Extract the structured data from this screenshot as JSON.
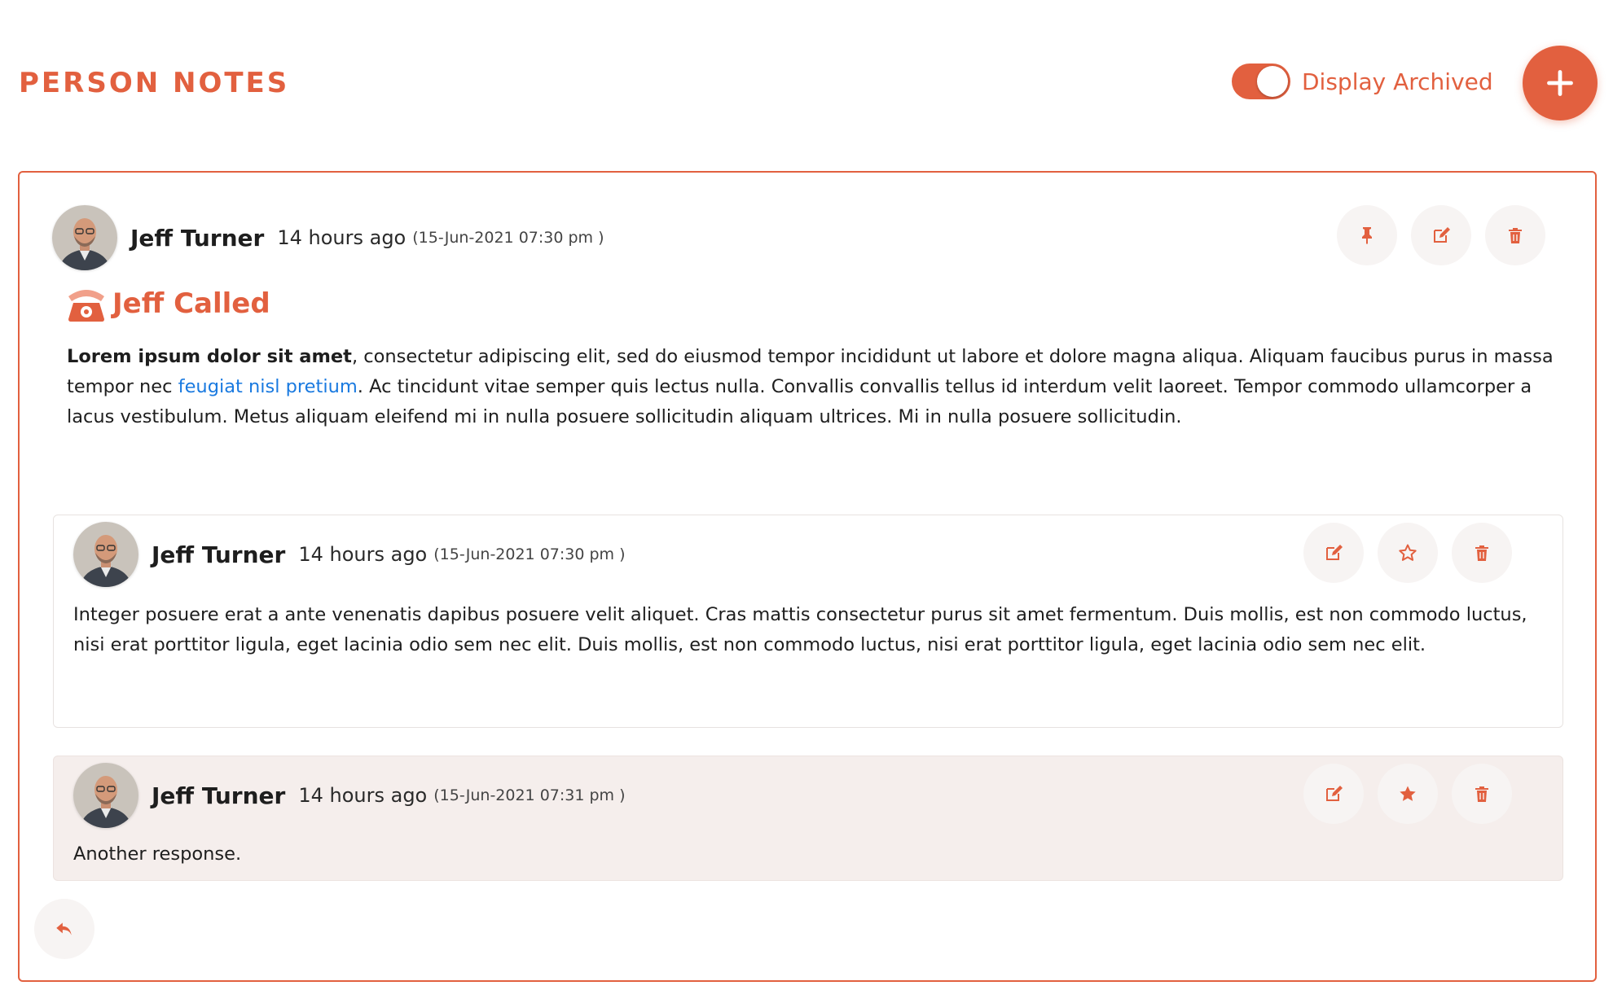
{
  "page": {
    "title": "PERSON NOTES",
    "display_archived_label": "Display Archived",
    "display_archived_on": true,
    "add_icon": "plus-icon"
  },
  "colors": {
    "accent": "#e2603f",
    "link": "#1a7ae0",
    "highlight_bg": "#f5eeec"
  },
  "note": {
    "author": "Jeff Turner",
    "time_ago": "14 hours ago",
    "timestamp": "(15-Jun-2021 07:30 pm )",
    "type_icon": "phone-icon",
    "title": "Jeff Called",
    "body_bold": "Lorem ipsum dolor sit amet",
    "body_part1": ", consectetur adipiscing elit, sed do eiusmod tempor incididunt ut labore et dolore magna aliqua. Aliquam faucibus purus in massa tempor nec ",
    "body_link": "feugiat nisl pretium",
    "body_part2": ". Ac tincidunt vitae semper quis lectus nulla. Convallis convallis tellus id interdum velit laoreet. Tempor commodo ullamcorper a lacus vestibulum. Metus aliquam eleifend mi in nulla posuere sollicitudin aliquam ultrices. Mi in nulla posuere sollicitudin.",
    "actions": [
      "pin-icon",
      "edit-icon",
      "trash-icon"
    ]
  },
  "replies": [
    {
      "author": "Jeff Turner",
      "time_ago": "14 hours ago",
      "timestamp": "(15-Jun-2021 07:30 pm )",
      "text": "Integer posuere erat a ante venenatis dapibus posuere velit aliquet. Cras mattis consectetur purus sit amet fermentum. Duis mollis, est non commodo luctus, nisi erat porttitor ligula, eget lacinia odio sem nec elit. Duis mollis, est non commodo luctus, nisi erat porttitor ligula, eget lacinia odio sem nec elit.",
      "starred": false,
      "actions": [
        "edit-icon",
        "star-outline-icon",
        "trash-icon"
      ]
    },
    {
      "author": "Jeff Turner",
      "time_ago": "14 hours ago",
      "timestamp": "(15-Jun-2021 07:31 pm )",
      "text": "Another response.",
      "starred": true,
      "actions": [
        "edit-icon",
        "star-filled-icon",
        "trash-icon"
      ]
    }
  ],
  "footer": {
    "reply_icon": "reply-icon"
  }
}
